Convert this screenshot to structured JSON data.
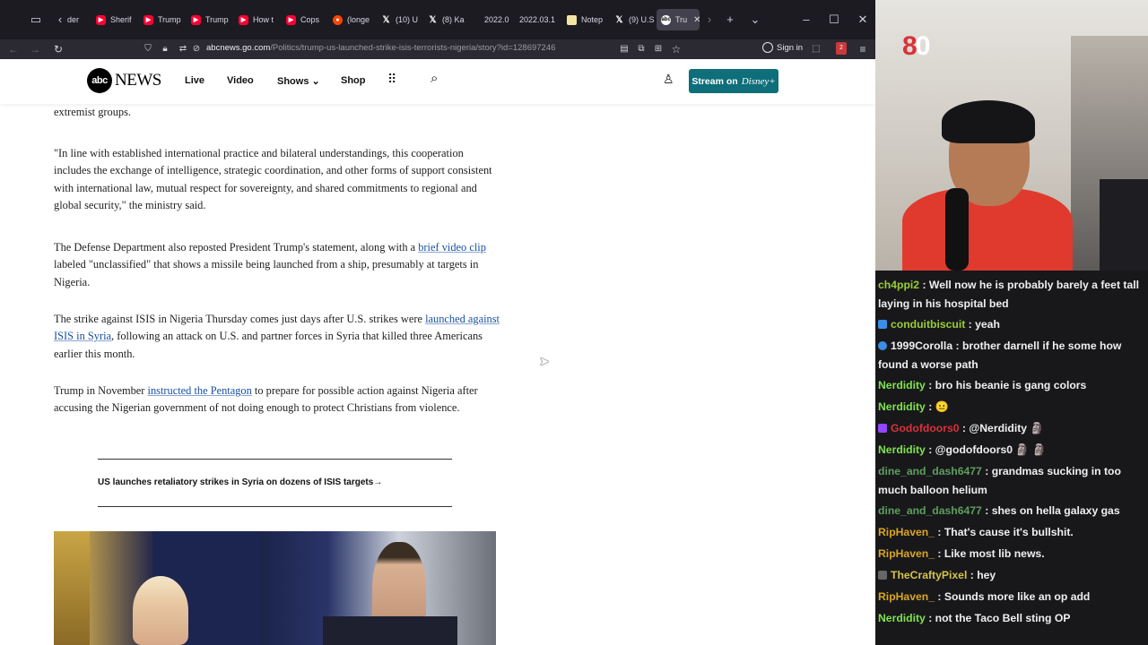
{
  "browser": {
    "tabs": [
      {
        "title": "der",
        "icon": "generic"
      },
      {
        "title": "Sherif",
        "icon": "youtube"
      },
      {
        "title": "Trump",
        "icon": "youtube"
      },
      {
        "title": "Trump",
        "icon": "youtube"
      },
      {
        "title": "How t",
        "icon": "youtube"
      },
      {
        "title": "Cops",
        "icon": "youtube"
      },
      {
        "title": "(longe",
        "icon": "reddit"
      },
      {
        "title": "(10) U",
        "icon": "x"
      },
      {
        "title": "(8) Ka",
        "icon": "x"
      },
      {
        "title": "2022.0",
        "icon": "generic"
      },
      {
        "title": "2022.03.1",
        "icon": "generic"
      },
      {
        "title": "Notep",
        "icon": "note"
      },
      {
        "title": "(9) U.S",
        "icon": "x"
      },
      {
        "title": "Tru",
        "icon": "abc",
        "active": true
      }
    ],
    "url_domain": "abcnews.go.com",
    "url_path": "/Politics/trump-us-launched-strike-isis-terrorists-nigeria/story?id=128697246",
    "sign_in_label": "Sign in",
    "ext_badge": "2"
  },
  "site": {
    "logo_mark": "abc",
    "logo_text": "NEWS",
    "nav": [
      "Live",
      "Video",
      "Shows",
      "Shop"
    ],
    "shows_chevron": "⌄",
    "stream_label": "Stream on",
    "stream_brand": "Disney+",
    "accent": "#0e6e7a"
  },
  "article": {
    "p0": "extremist groups.",
    "p1": "\"In line with established international practice and bilateral understandings, this cooperation includes the exchange of intelligence, strategic coordination, and other forms of support consistent with international law, mutual respect for sovereignty, and shared commitments to regional and global security,\" the ministry said.",
    "p2_pre": "The Defense Department also reposted President Trump's statement, along with a ",
    "p2_link": "brief video clip",
    "p2_post": " labeled \"unclassified\" that shows a missile being launched from a ship, presumably at targets in Nigeria.",
    "p3_pre": "The strike against ISIS in Nigeria Thursday comes just days after U.S. strikes were ",
    "p3_link": "launched against ISIS in Syria",
    "p3_post": ", following an attack on U.S. and partner forces in Syria that killed three Americans earlier this month.",
    "p4_pre": "Trump in November ",
    "p4_link": "instructed the Pentagon",
    "p4_post": " to prepare for possible action against Nigeria after accusing the Nigerian government of not doing enough to protect Christians from violence.",
    "related": "US launches retaliatory strikes in Syria on dozens of ISIS targets",
    "related_arrow": "→"
  },
  "webcam": {
    "label_red": "8",
    "label_white": "0"
  },
  "chat": [
    {
      "user": "ch4ppi2",
      "color": "#9acd32",
      "text": "Well now he is probably barely a feet tall laying in his hospital bed"
    },
    {
      "user": "conduitbiscuit",
      "color": "#9acd32",
      "text": "yeah",
      "badge": "#3a8ee6"
    },
    {
      "user": "1999Corolla",
      "color": "#efeff1",
      "text": "brother darnell if he some how found a worse path",
      "badge": "#3a8ee6"
    },
    {
      "user": "Nerdidity",
      "color": "#7fe34a",
      "text": "bro his beanie is gang colors"
    },
    {
      "user": "Nerdidity",
      "color": "#7fe34a",
      "text": "😐"
    },
    {
      "user": "Godofdoors0",
      "color": "#d8323a",
      "text": "@Nerdidity 🗿",
      "badge": "#9146ff"
    },
    {
      "user": "Nerdidity",
      "color": "#7fe34a",
      "text": "@godofdoors0 🗿 🗿"
    },
    {
      "user": "dine_and_dash6477",
      "color": "#5e9e5e",
      "text": "grandmas sucking in too much balloon helium"
    },
    {
      "user": "dine_and_dash6477",
      "color": "#5e9e5e",
      "text": "shes on hella galaxy gas"
    },
    {
      "user": "RipHaven_",
      "color": "#daa520",
      "text": "That's cause it's bullshit."
    },
    {
      "user": "RipHaven_",
      "color": "#daa520",
      "text": "Like most lib news."
    },
    {
      "user": "TheCraftyPixel",
      "color": "#d4c34a",
      "text": "hey",
      "badge": "#666"
    },
    {
      "user": "RipHaven_",
      "color": "#daa520",
      "text": "Sounds more like an op add"
    },
    {
      "user": "Nerdidity",
      "color": "#7fe34a",
      "text": "not the Taco Bell sting OP"
    }
  ]
}
